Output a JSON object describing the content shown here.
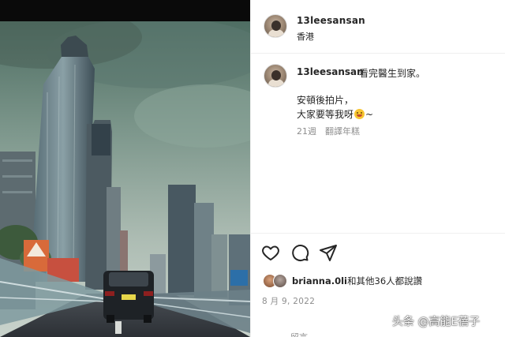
{
  "post": {
    "username": "13leesansan",
    "location": "香港",
    "caption": {
      "username": "13leesansan",
      "text": "看完醫生到家。",
      "line2": "安頓後拍片，",
      "line3_before_emoji": "大家要等我呀",
      "line3_after_emoji": "~",
      "emoji_icon": "smiling-face-emoji"
    },
    "caption_age": "21週",
    "translate_label": "翻譯年糕",
    "likes": {
      "first_liker": "brianna.0li",
      "rest": "和其他36人都說讚"
    },
    "date": "8 月 9, 2022",
    "comment_placeholder": "留言……"
  },
  "actions": {
    "like_icon": "heart-icon",
    "comment_icon": "comment-icon",
    "share_icon": "send-icon"
  },
  "watermark": "头条 @高能E蓓子",
  "colors": {
    "text": "#262626",
    "secondary": "#8e8e8e",
    "divider": "#efefef"
  }
}
